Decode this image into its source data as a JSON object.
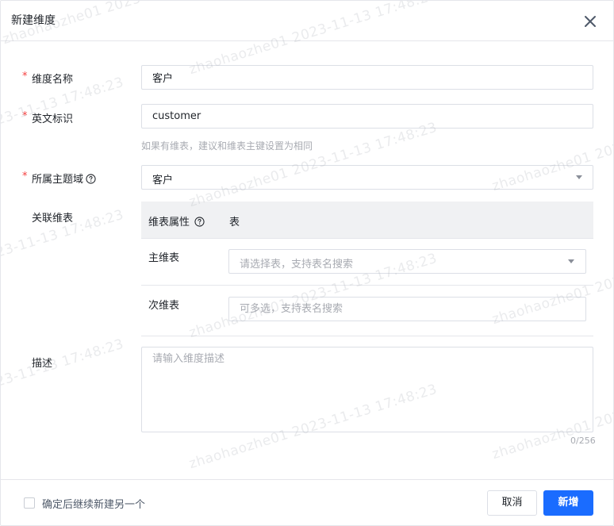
{
  "dialog": {
    "title": "新建维度",
    "close_icon": "close-icon"
  },
  "form": {
    "name": {
      "required_mark": "*",
      "label": "维度名称",
      "value": "客户"
    },
    "en_id": {
      "required_mark": "*",
      "label": "英文标识",
      "value": "customer",
      "hint": "如果有维表，建议和维表主键设置为相同"
    },
    "topic": {
      "required_mark": "*",
      "label": "所属主题域",
      "help_icon": "question-circle-icon",
      "value": "客户"
    },
    "linked_tables": {
      "label": "关联维表",
      "header_attr": "维表属性",
      "header_table": "表",
      "main_label": "主维表",
      "main_placeholder": "请选择表，支持表名搜索",
      "secondary_label": "次维表",
      "secondary_placeholder": "可多选，支持表名搜索"
    },
    "description": {
      "label": "描述",
      "placeholder": "请输入维度描述",
      "counter": "0/256"
    }
  },
  "footer": {
    "continue_label": "确定后继续新建另一个",
    "cancel_label": "取消",
    "submit_label": "新增"
  },
  "watermark_text": "zhaohaozhe01 2023-11-13 17:48:23",
  "colors": {
    "primary": "#1a6cff",
    "required": "#f53f3f",
    "placeholder": "#a8abb2",
    "table_header_bg": "#f0f1f3"
  }
}
